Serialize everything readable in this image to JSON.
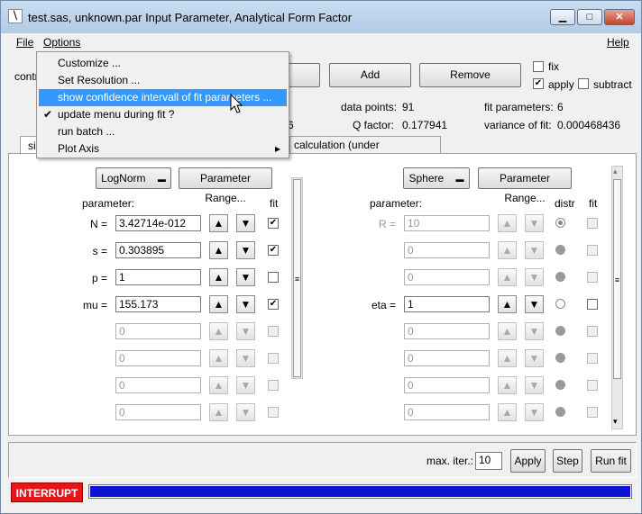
{
  "window": {
    "title": "test.sas, unknown.par Input Parameter, Analytical Form Factor"
  },
  "menubar": {
    "file": "File",
    "options": "Options",
    "help": "Help"
  },
  "options_menu": {
    "items": [
      "Customize ...",
      "Set Resolution ...",
      "show confidence intervall of fit parameters ...",
      "update menu during fit ?",
      "run batch ...",
      "Plot Axis"
    ],
    "checked": "✔",
    "submenu_arrow": "▸"
  },
  "toolbar": {
    "partial_label": "contr",
    "add": "Add",
    "remove": "Remove",
    "fix": "fix",
    "apply": "apply",
    "subtract": "subtract"
  },
  "stats": {
    "data_points_label": "data points:",
    "data_points": "91",
    "fit_parameters_label": "fit parameters:",
    "fit_parameters": "6",
    "q_factor_label": "Q factor:",
    "q_factor": "0.177941",
    "variance_label": "variance of fit:",
    "variance": "0.000468436",
    "partial_value": "6"
  },
  "tabs": {
    "partial_left": "siz",
    "calc": "calculation (under construction)"
  },
  "left_panel": {
    "distribution": "LogNorm",
    "param_range": "Parameter Range...",
    "parameter_header": "parameter:",
    "fit_header": "fit",
    "rows": [
      {
        "label": "N =",
        "value": "3.42714e-012",
        "fit": "✔"
      },
      {
        "label": "s =",
        "value": "0.303895",
        "fit": "✔"
      },
      {
        "label": "p =",
        "value": "1",
        "fit": ""
      },
      {
        "label": "mu =",
        "value": "155.173",
        "fit": "✔"
      },
      {
        "label": "",
        "value": "0",
        "fit": ""
      },
      {
        "label": "",
        "value": "0",
        "fit": ""
      },
      {
        "label": "",
        "value": "0",
        "fit": ""
      },
      {
        "label": "",
        "value": "0",
        "fit": ""
      }
    ]
  },
  "right_panel": {
    "form_factor": "Sphere",
    "param_range": "Parameter Range...",
    "parameter_header": "parameter:",
    "distr_header": "distr",
    "fit_header": "fit",
    "rows": [
      {
        "label": "R =",
        "value": "10"
      },
      {
        "label": "",
        "value": "0"
      },
      {
        "label": "",
        "value": "0"
      },
      {
        "label": "eta =",
        "value": "1"
      },
      {
        "label": "",
        "value": "0"
      },
      {
        "label": "",
        "value": "0"
      },
      {
        "label": "",
        "value": "0"
      },
      {
        "label": "",
        "value": "0"
      }
    ]
  },
  "footer": {
    "max_iter_label": "max. iter.:",
    "max_iter": "10",
    "apply": "Apply",
    "step": "Step",
    "run_fit": "Run fit",
    "interrupt": "INTERRUPT",
    "progress": 1.0
  },
  "icons": {
    "up": "▲",
    "down": "▼",
    "dropdown": "▬",
    "grip": "≡",
    "scroll_down": "▾",
    "scroll_up": "▴",
    "minimize": "▁",
    "maximize": "□",
    "close": "✕",
    "check": "✔"
  },
  "colors": {
    "interrupt": "#e8141c",
    "progress": "#0a14d2",
    "highlight": "#3399ff"
  }
}
